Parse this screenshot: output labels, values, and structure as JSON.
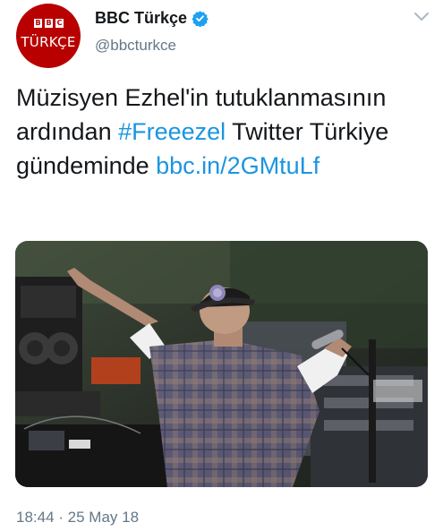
{
  "account": {
    "display_name": "BBC Türkçe",
    "handle": "@bbcturkce",
    "avatar_logo": {
      "b1": "B",
      "b2": "B",
      "b3": "C",
      "word": "TÜRKÇE"
    },
    "verified_icon": "verified-badge-icon",
    "menu_icon": "chevron-down-icon"
  },
  "tweet": {
    "text_1": "Müzisyen Ezhel'in tutuklanmasının ardından ",
    "hashtag": "#Freeezel",
    "text_2": " Twitter Türkiye gündeminde ",
    "link": "bbc.in/2GMtuLf"
  },
  "media": {
    "description_icon": "photo-of-performer-on-stage"
  },
  "meta": {
    "timestamp": "18:44 · 25 May 18"
  },
  "colors": {
    "link": "#1b95e0",
    "muted": "#657786",
    "brand_red": "#b80000",
    "verified": "#1da1f2"
  }
}
